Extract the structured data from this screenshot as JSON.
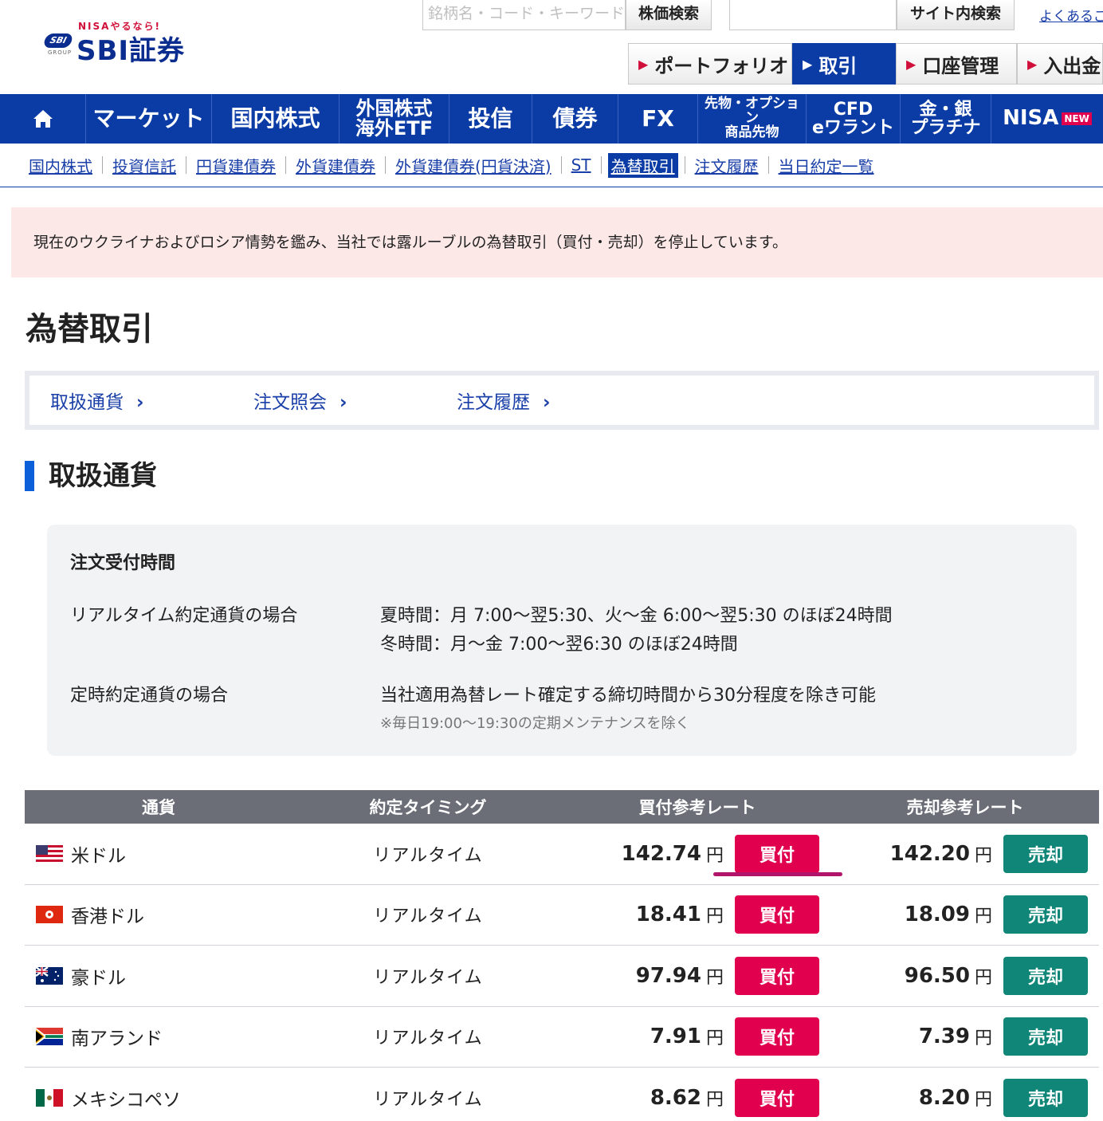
{
  "header": {
    "logo_tagline": "NISAやるなら!",
    "logo_badge": "SBI",
    "logo_badge_sub": "GROUP",
    "logo_text": "SBI証券",
    "search_placeholder": "銘柄名・コード・キーワード",
    "search_button": "株価検索",
    "site_search_button": "サイト内検索",
    "faq_link": "よくあるご"
  },
  "main_tabs": [
    {
      "label": "ポートフォリオ"
    },
    {
      "label": "取引"
    },
    {
      "label": "口座管理"
    },
    {
      "label": "入出金"
    }
  ],
  "nav": {
    "home": "home-icon",
    "items": [
      {
        "label": "マーケット"
      },
      {
        "label": "国内株式"
      },
      {
        "line1": "外国株式",
        "line2": "海外ETF"
      },
      {
        "label": "投信"
      },
      {
        "label": "債券"
      },
      {
        "label": "FX"
      },
      {
        "line1": "先物・オプション",
        "line2": "商品先物"
      },
      {
        "line1": "CFD",
        "line2": "eワラント"
      },
      {
        "line1": "金・銀",
        "line2": "プラチナ"
      },
      {
        "label": "NISA",
        "badge": "NEW"
      }
    ]
  },
  "subnav": [
    {
      "label": "国内株式"
    },
    {
      "label": "投資信託"
    },
    {
      "label": "円貨建債券"
    },
    {
      "label": "外貨建債券"
    },
    {
      "label": "外貨建債券(円貨決済)"
    },
    {
      "label": "ST"
    },
    {
      "label": "為替取引"
    },
    {
      "label": "注文履歴"
    },
    {
      "label": "当日約定一覧"
    }
  ],
  "notice": "現在のウクライナおよびロシア情勢を鑑み、当社では露ルーブルの為替取引（買付・売却）を停止しています。",
  "page_title": "為替取引",
  "anchors": [
    {
      "label": "取扱通貨"
    },
    {
      "label": "注文照会"
    },
    {
      "label": "注文履歴"
    }
  ],
  "section_title": "取扱通貨",
  "info": {
    "heading": "注文受付時間",
    "realtime_label": "リアルタイム約定通貨の場合",
    "realtime_summer": "夏時間：月 7:00～翌5:30、火～金 6:00～翌5:30 のほぼ24時間",
    "realtime_winter": "冬時間：月～金 7:00～翌6:30 のほぼ24時間",
    "fixed_label": "定時約定通貨の場合",
    "fixed_value": "当社適用為替レート確定する締切時間から30分程度を除き可能",
    "fixed_note": "※毎日19:00～19:30の定期メンテナンスを除く"
  },
  "table": {
    "headers": [
      "通貨",
      "約定タイミング",
      "買付参考レート",
      "売却参考レート"
    ],
    "yen_unit": "円",
    "buy_label": "買付",
    "sell_label": "売却",
    "rows": [
      {
        "currency": "米ドル",
        "flag": "us-flag-icon",
        "timing": "リアルタイム",
        "buy_rate": "142.74",
        "sell_rate": "142.20"
      },
      {
        "currency": "香港ドル",
        "flag": "hk-flag-icon",
        "timing": "リアルタイム",
        "buy_rate": "18.41",
        "sell_rate": "18.09"
      },
      {
        "currency": "豪ドル",
        "flag": "au-flag-icon",
        "timing": "リアルタイム",
        "buy_rate": "97.94",
        "sell_rate": "96.50"
      },
      {
        "currency": "南アランド",
        "flag": "za-flag-icon",
        "timing": "リアルタイム",
        "buy_rate": "7.91",
        "sell_rate": "7.39"
      },
      {
        "currency": "メキシコペソ",
        "flag": "mx-flag-icon",
        "timing": "リアルタイム",
        "buy_rate": "8.62",
        "sell_rate": "8.20"
      }
    ]
  },
  "colors": {
    "brand_blue": "#0b3ba4",
    "buy_red": "#e0004d",
    "sell_green": "#0f8677",
    "notice_bg": "#fde8e8"
  }
}
